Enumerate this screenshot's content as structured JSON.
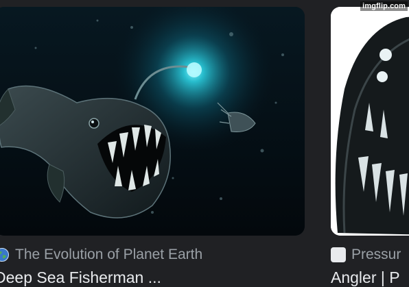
{
  "watermark": "imgflip.com",
  "results": [
    {
      "source": "The Evolution of Planet Earth",
      "title": "Deep Sea Fisherman ...",
      "favicon": "globe-icon",
      "image": "anglerfish-glowing-lure-image"
    },
    {
      "source": "Pressur",
      "title": "Angler | P",
      "favicon": "site-icon",
      "image": "anglerfish-illustration-image"
    }
  ],
  "colors": {
    "background": "#202124",
    "source_text": "#9aa0a6",
    "title_text": "#e8eaed",
    "lure_glow": "#29c5d6"
  }
}
